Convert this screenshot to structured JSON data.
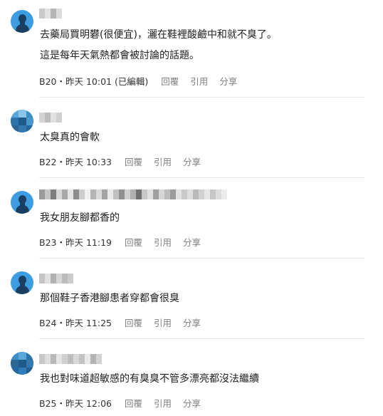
{
  "comments": [
    {
      "floor": "B20",
      "time": "昨天 10:01 (已編輯)",
      "lines": [
        "去藥局買明礬(很便宜)，灑在鞋裡酸鹼中和就不臭了。",
        "這是每年天氣熱都會被討論的話題。"
      ]
    },
    {
      "floor": "B22",
      "time": "昨天 10:33",
      "lines": [
        "太臭真的會軟"
      ]
    },
    {
      "floor": "B23",
      "time": "昨天 11:19",
      "lines": [
        "我女朋友腳都香的"
      ]
    },
    {
      "floor": "B24",
      "time": "昨天 11:25",
      "lines": [
        "那個鞋子香港腳患者穿都會很臭"
      ]
    },
    {
      "floor": "B25",
      "time": "昨天 12:06",
      "lines": [
        "我也對味道超敏感的有臭臭不管多漂亮都沒法繼續"
      ]
    }
  ],
  "labels": {
    "separator": "・",
    "reply": "回覆",
    "quote": "引用",
    "share": "分享"
  },
  "colors": {
    "avatar_blue": "#3d9de0",
    "avatar_figure": "#1b3f60",
    "action_gray": "#808080",
    "divider": "#e6e6e6"
  }
}
